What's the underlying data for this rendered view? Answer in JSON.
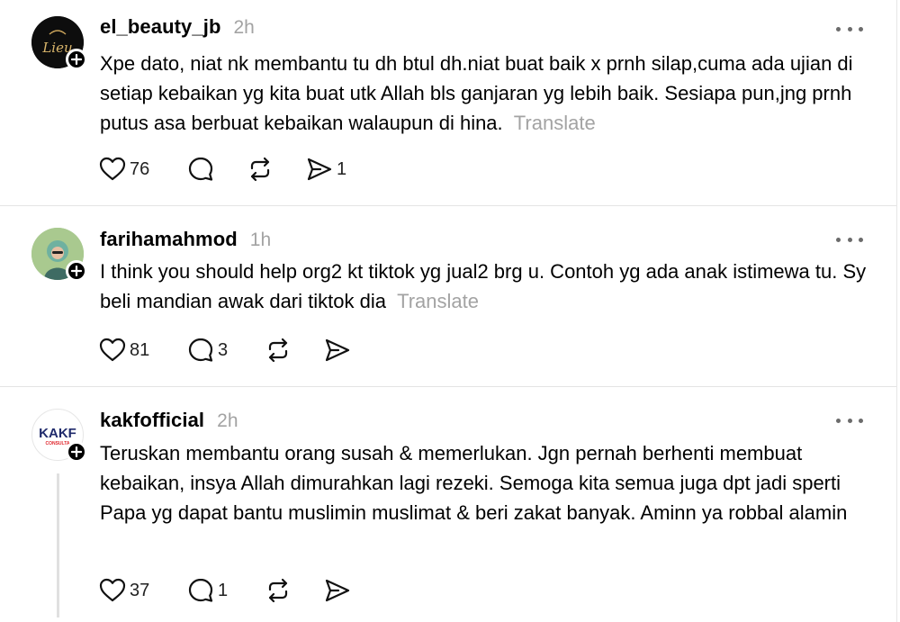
{
  "posts": [
    {
      "username": "el_beauty_jb",
      "time": "2h",
      "avatar_text": "Lieu",
      "text": "Xpe dato, niat nk membantu tu dh btul dh.niat buat baik x prnh silap,cuma ada ujian di setiap kebaikan yg kita buat utk Allah bls ganjaran yg lebih baik. Sesiapa pun,jng prnh putus asa berbuat kebaikan walaupun di hina.",
      "translate": "Translate",
      "likes": "76",
      "replies": "",
      "shares": "1"
    },
    {
      "username": "farihamahmod",
      "time": "1h",
      "avatar_text": "",
      "text": "I think you should help org2 kt tiktok yg jual2 brg u. Contoh yg ada anak istimewa tu. Sy beli mandian awak dari tiktok dia",
      "translate": "Translate",
      "likes": "81",
      "replies": "3",
      "shares": ""
    },
    {
      "username": "kakfofficial",
      "time": "2h",
      "avatar_text": "KAKF",
      "avatar_subtext": "CONSULTA",
      "text": "Teruskan membantu orang susah & memerlukan. Jgn pernah berhenti membuat kebaikan, insya Allah dimurahkan lagi rezeki. Semoga kita semua juga dpt jadi sperti Papa yg dapat bantu muslimin muslimat & beri zakat banyak. Aminn ya robbal alamin",
      "translate": "",
      "likes": "37",
      "replies": "1",
      "shares": ""
    }
  ],
  "colors": {
    "muted": "#a3a3a3",
    "divider": "#e4e4e4",
    "kakf_red": "#e0282e",
    "kakf_navy": "#1f2a6b"
  }
}
